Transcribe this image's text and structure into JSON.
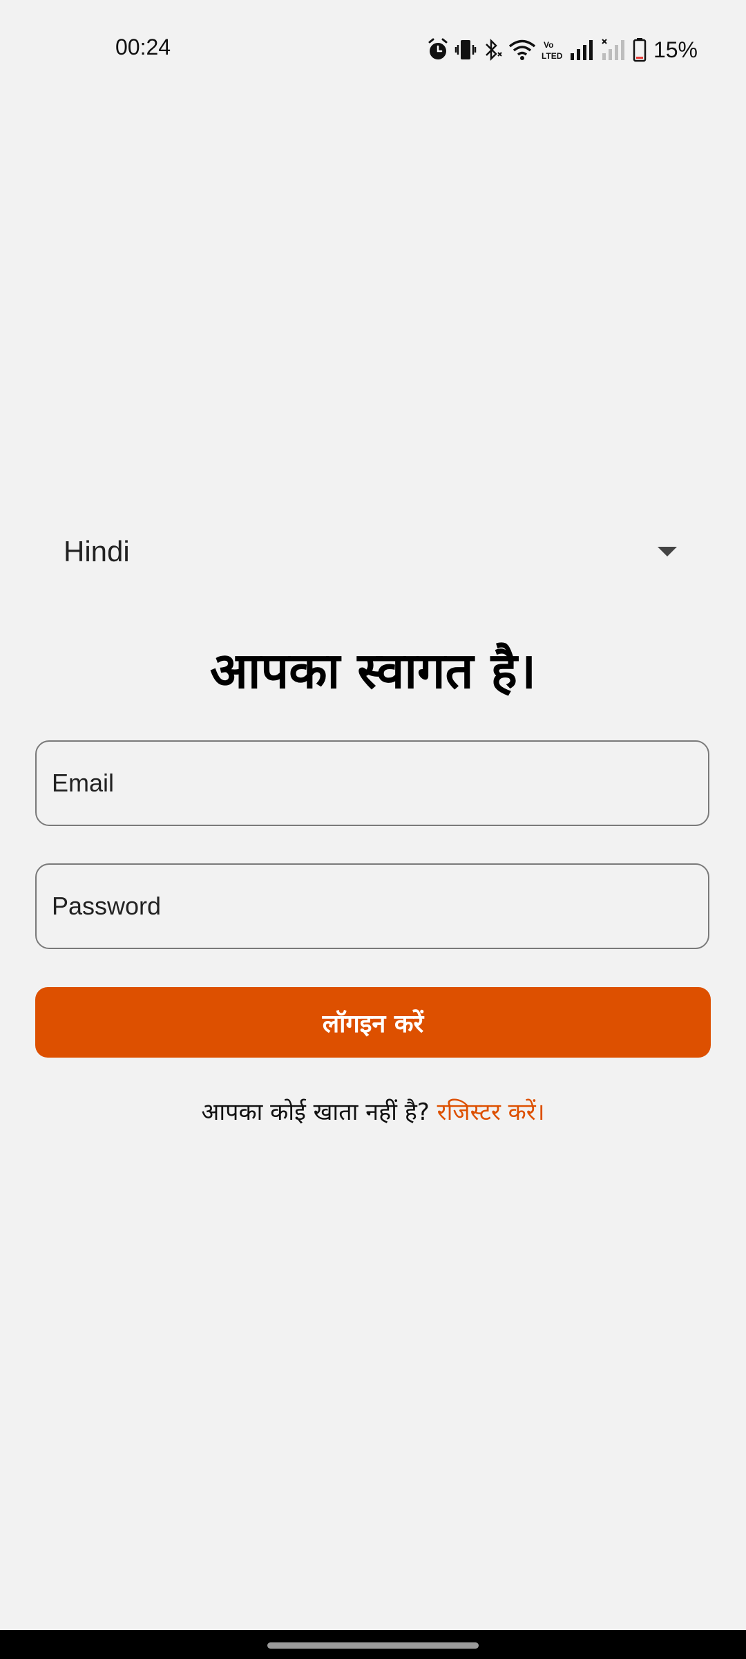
{
  "status_bar": {
    "time": "00:24",
    "volte_label": "Vo LTED",
    "battery_percent": "15%",
    "icons": [
      "alarm-icon",
      "vibrate-icon",
      "bluetooth-icon",
      "wifi-icon",
      "volte-icon",
      "signal-icon",
      "signal-no-service-icon",
      "battery-icon"
    ]
  },
  "language": {
    "selected": "Hindi"
  },
  "welcome": {
    "title": "आपका स्वागत है।"
  },
  "form": {
    "email_placeholder": "Email",
    "password_placeholder": "Password",
    "login_label": "लॉगइन करें"
  },
  "register": {
    "prompt": "आपका कोई खाता नहीं है?",
    "link_label": "रजिस्टर करें।"
  },
  "colors": {
    "accent": "#dd5000",
    "background": "#f2f2f2"
  }
}
